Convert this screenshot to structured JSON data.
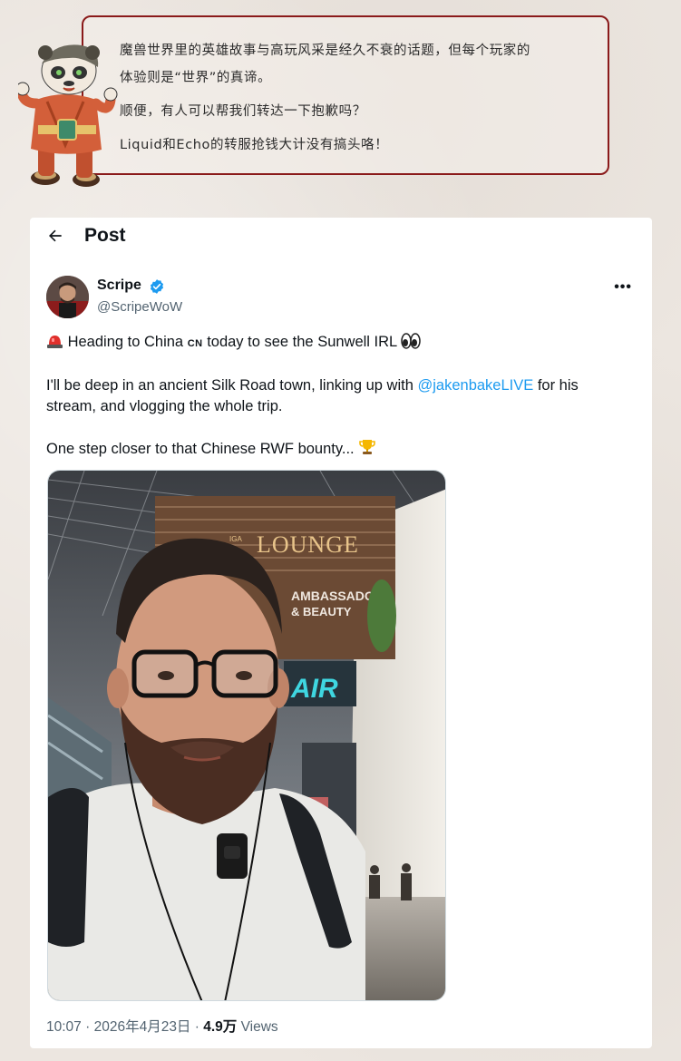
{
  "intro": {
    "line1": "魔兽世界里的英雄故事与高玩风采是经久不衰的话题，但每个玩家的",
    "line2": "体验则是“世界”的真谛。",
    "line3": "顺便，有人可以帮我们转达一下抱歉吗？",
    "line4": "Liquid和Echo的转服抢钱大计没有搞头咯！"
  },
  "post": {
    "title": "Post",
    "author_name": "Scripe",
    "author_handle": "@ScripeWoW",
    "text_line1_a": "Heading to China",
    "text_line1_flag": "CN",
    "text_line1_b": "today to see the Sunwell IRL",
    "text_line2_a": "I'll be deep in an ancient Silk Road town, linking up with",
    "text_line2_mention": "@jakenbakeLIVE",
    "text_line2_b": "for his",
    "text_line3": "stream, and vlogging the whole trip.",
    "text_line4": "One step closer to that Chinese RWF bounty...",
    "time": "10:07",
    "sep": "·",
    "date": "2026年4月23日",
    "views_count": "4.9万",
    "views_label": "Views"
  },
  "photo_signs": {
    "lounge_prefix": "IGA",
    "lounge": "LOUNGE",
    "ambassador": "AMBASSADOR",
    "beauty": "& BEAUTY",
    "air": "AIR"
  },
  "icons": {
    "back": "back-arrow-icon",
    "verified": "verified-badge-icon",
    "more": "more-options-icon",
    "siren": "rotating-light-emoji",
    "eyes": "eyes-emoji",
    "trophy": "trophy-emoji"
  },
  "colors": {
    "accent": "#1d9bf0",
    "box_border": "#8a1a1a",
    "text": "#0f1419",
    "secondary": "#536471"
  }
}
